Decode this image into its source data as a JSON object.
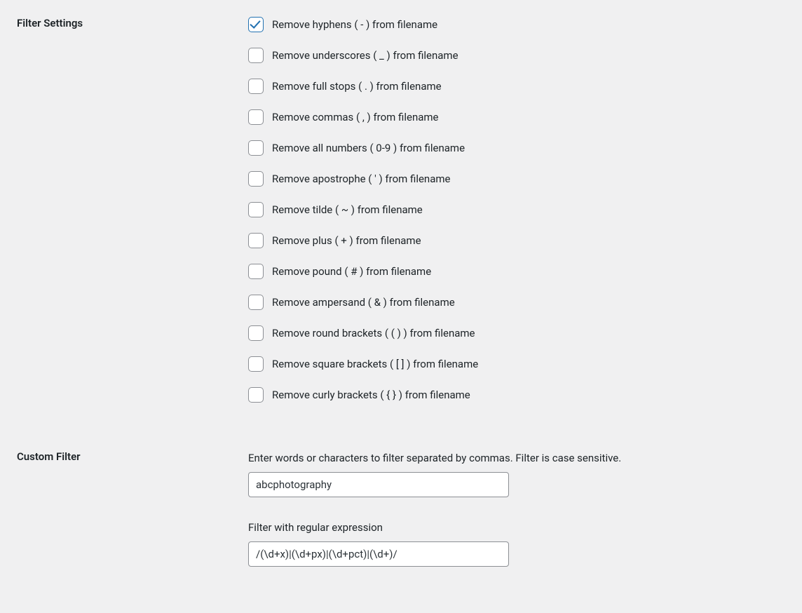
{
  "filterSettings": {
    "heading": "Filter Settings",
    "options": [
      {
        "label": "Remove hyphens ( - ) from filename",
        "checked": true
      },
      {
        "label": "Remove underscores ( _ ) from filename",
        "checked": false
      },
      {
        "label": "Remove full stops ( . ) from filename",
        "checked": false
      },
      {
        "label": "Remove commas ( , ) from filename",
        "checked": false
      },
      {
        "label": "Remove all numbers ( 0-9 ) from filename",
        "checked": false
      },
      {
        "label": "Remove apostrophe ( ' ) from filename",
        "checked": false
      },
      {
        "label": "Remove tilde ( ~ ) from filename",
        "checked": false
      },
      {
        "label": "Remove plus ( + ) from filename",
        "checked": false
      },
      {
        "label": "Remove pound ( # ) from filename",
        "checked": false
      },
      {
        "label": "Remove ampersand ( & ) from filename",
        "checked": false
      },
      {
        "label": "Remove round brackets ( ( ) ) from filename",
        "checked": false
      },
      {
        "label": "Remove square brackets ( [ ] ) from filename",
        "checked": false
      },
      {
        "label": "Remove curly brackets ( { } ) from filename",
        "checked": false
      }
    ]
  },
  "customFilter": {
    "heading": "Custom Filter",
    "wordsDescription": "Enter words or characters to filter separated by commas. Filter is case sensitive.",
    "wordsValue": "abcphotography",
    "regexDescription": "Filter with regular expression",
    "regexValue": "/(\\d+x)|(\\d+px)|(\\d+pct)|(\\d+)/"
  }
}
